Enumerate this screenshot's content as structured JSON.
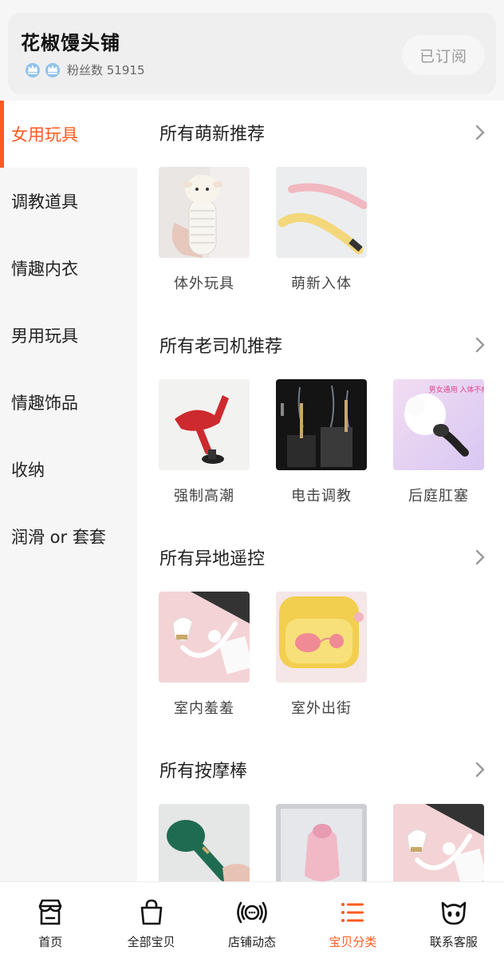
{
  "shop": {
    "name": "花椒馒头铺",
    "fans_label": "粉丝数 51915",
    "subscribe_label": "已订阅"
  },
  "sidebar": {
    "items": [
      {
        "label": "女用玩具",
        "active": true
      },
      {
        "label": "调教道具"
      },
      {
        "label": "情趣内衣"
      },
      {
        "label": "男用玩具"
      },
      {
        "label": "情趣饰品"
      },
      {
        "label": "收纳"
      },
      {
        "label": "润滑 or 套套"
      }
    ]
  },
  "sections": [
    {
      "title": "所有萌新推荐",
      "items": [
        {
          "label": "体外玩具"
        },
        {
          "label": "萌新入体"
        }
      ]
    },
    {
      "title": "所有老司机推荐",
      "items": [
        {
          "label": "强制高潮"
        },
        {
          "label": "电击调教"
        },
        {
          "label": "后庭肛塞"
        }
      ]
    },
    {
      "title": "所有异地遥控",
      "items": [
        {
          "label": "室内羞羞"
        },
        {
          "label": "室外出街"
        }
      ]
    },
    {
      "title": "所有按摩棒",
      "items": [
        {
          "label": ""
        },
        {
          "label": ""
        },
        {
          "label": ""
        }
      ]
    }
  ],
  "product_image_text": {
    "anal_plug_caption": "男女通用 入体不疼"
  },
  "bottom_nav": {
    "items": [
      {
        "label": "首页",
        "icon": "shop-icon"
      },
      {
        "label": "全部宝贝",
        "icon": "bag-icon"
      },
      {
        "label": "店铺动态",
        "icon": "broadcast-icon"
      },
      {
        "label": "宝贝分类",
        "icon": "category-list-icon",
        "active": true
      },
      {
        "label": "联系客服",
        "icon": "service-face-icon"
      }
    ]
  },
  "colors": {
    "accent": "#ff5a1f",
    "background": "#f6f6f6"
  }
}
